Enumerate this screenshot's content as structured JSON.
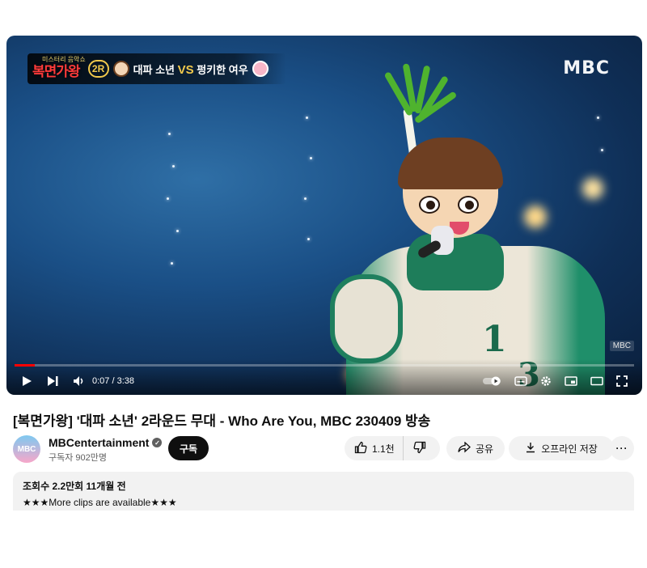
{
  "video": {
    "overlay": {
      "show_logo": "복면가왕",
      "show_subtitle": "미스터리 음악쇼",
      "round": "2R",
      "contestant_a": "대파 소년",
      "vs": "VS",
      "contestant_b": "펑키한 여우",
      "broadcaster": "MBC",
      "broadcaster_small": "MBC"
    },
    "player": {
      "current_time": "0:07",
      "duration": "3:38",
      "time_display": "0:07 / 3:38",
      "progress_fraction": 0.032
    }
  },
  "title": "[복면가왕] '대파 소년' 2라운드 무대 - Who Are You, MBC 230409 방송",
  "channel": {
    "avatar_text": "MBC",
    "name": "MBCentertainment",
    "verified_mark": "✓",
    "subscribers": "구독자 902만명",
    "subscribe_label": "구독"
  },
  "actions": {
    "like_count": "1.1천",
    "share_label": "공유",
    "download_label": "오프라인 저장",
    "more_label": "···"
  },
  "description": {
    "meta": "조회수 2.2만회  11개월 전",
    "text": "★★★More clips are available★★★"
  },
  "colors": {
    "progress": "#ff0000",
    "subscribe_bg": "#0f0f0f",
    "pill_bg": "#f2f2f2"
  }
}
